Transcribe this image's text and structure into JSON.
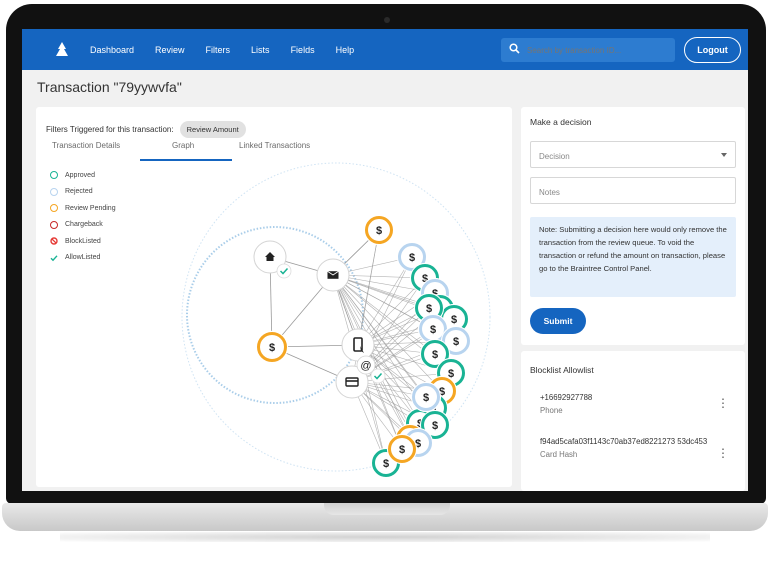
{
  "nav": {
    "items": [
      "Dashboard",
      "Review",
      "Filters",
      "Lists",
      "Fields",
      "Help"
    ],
    "search_placeholder": "Search by transaction ID...",
    "logout_label": "Logout"
  },
  "page": {
    "title": "Transaction \"79yywvfa\""
  },
  "filters": {
    "label": "Filters Triggered for this transaction:",
    "chip": "Review Amount"
  },
  "tabs": [
    {
      "label": "Transaction Details",
      "active": false
    },
    {
      "label": "Graph",
      "active": true
    },
    {
      "label": "Linked Transactions",
      "active": false
    }
  ],
  "legend": [
    {
      "label": "Approved",
      "icon": "approved-icon",
      "color": "#19b394"
    },
    {
      "label": "Rejected",
      "icon": "rejected-icon",
      "color": "#b8d4ef"
    },
    {
      "label": "Review Pending",
      "icon": "review-pending-icon",
      "color": "#f5a623"
    },
    {
      "label": "Chargeback",
      "icon": "chargeback-icon",
      "color": "#c62828"
    },
    {
      "label": "BlockListed",
      "icon": "blocklisted-icon",
      "color": "#e53935"
    },
    {
      "label": "AllowListed",
      "icon": "allowlisted-icon",
      "color": "#19b394"
    }
  ],
  "graph_icons": [
    "home-icon",
    "mail-icon",
    "phone-icon",
    "at-icon",
    "card-icon",
    "dollar-icon"
  ],
  "decision": {
    "title": "Make a decision",
    "select_placeholder": "Decision",
    "notes_placeholder": "Notes",
    "note": "Note: Submitting a decision here would only remove the transaction from the review queue. To void the transaction or refund the amount on transaction, please go to the Braintree Control Panel.",
    "submit_label": "Submit"
  },
  "blocklist": {
    "title": "Blocklist Allowlist",
    "items": [
      {
        "value": "+16692927788",
        "type": "Phone"
      },
      {
        "value": "f94ad5cafa03f1143c70ab37ed8221273 53dc453",
        "type": "Card Hash"
      }
    ]
  },
  "colors": {
    "nav": "#1565c0",
    "approved": "#19b394",
    "pending": "#f5a623",
    "rejected": "#b8d4ef",
    "edge": "#9a9a9a"
  }
}
